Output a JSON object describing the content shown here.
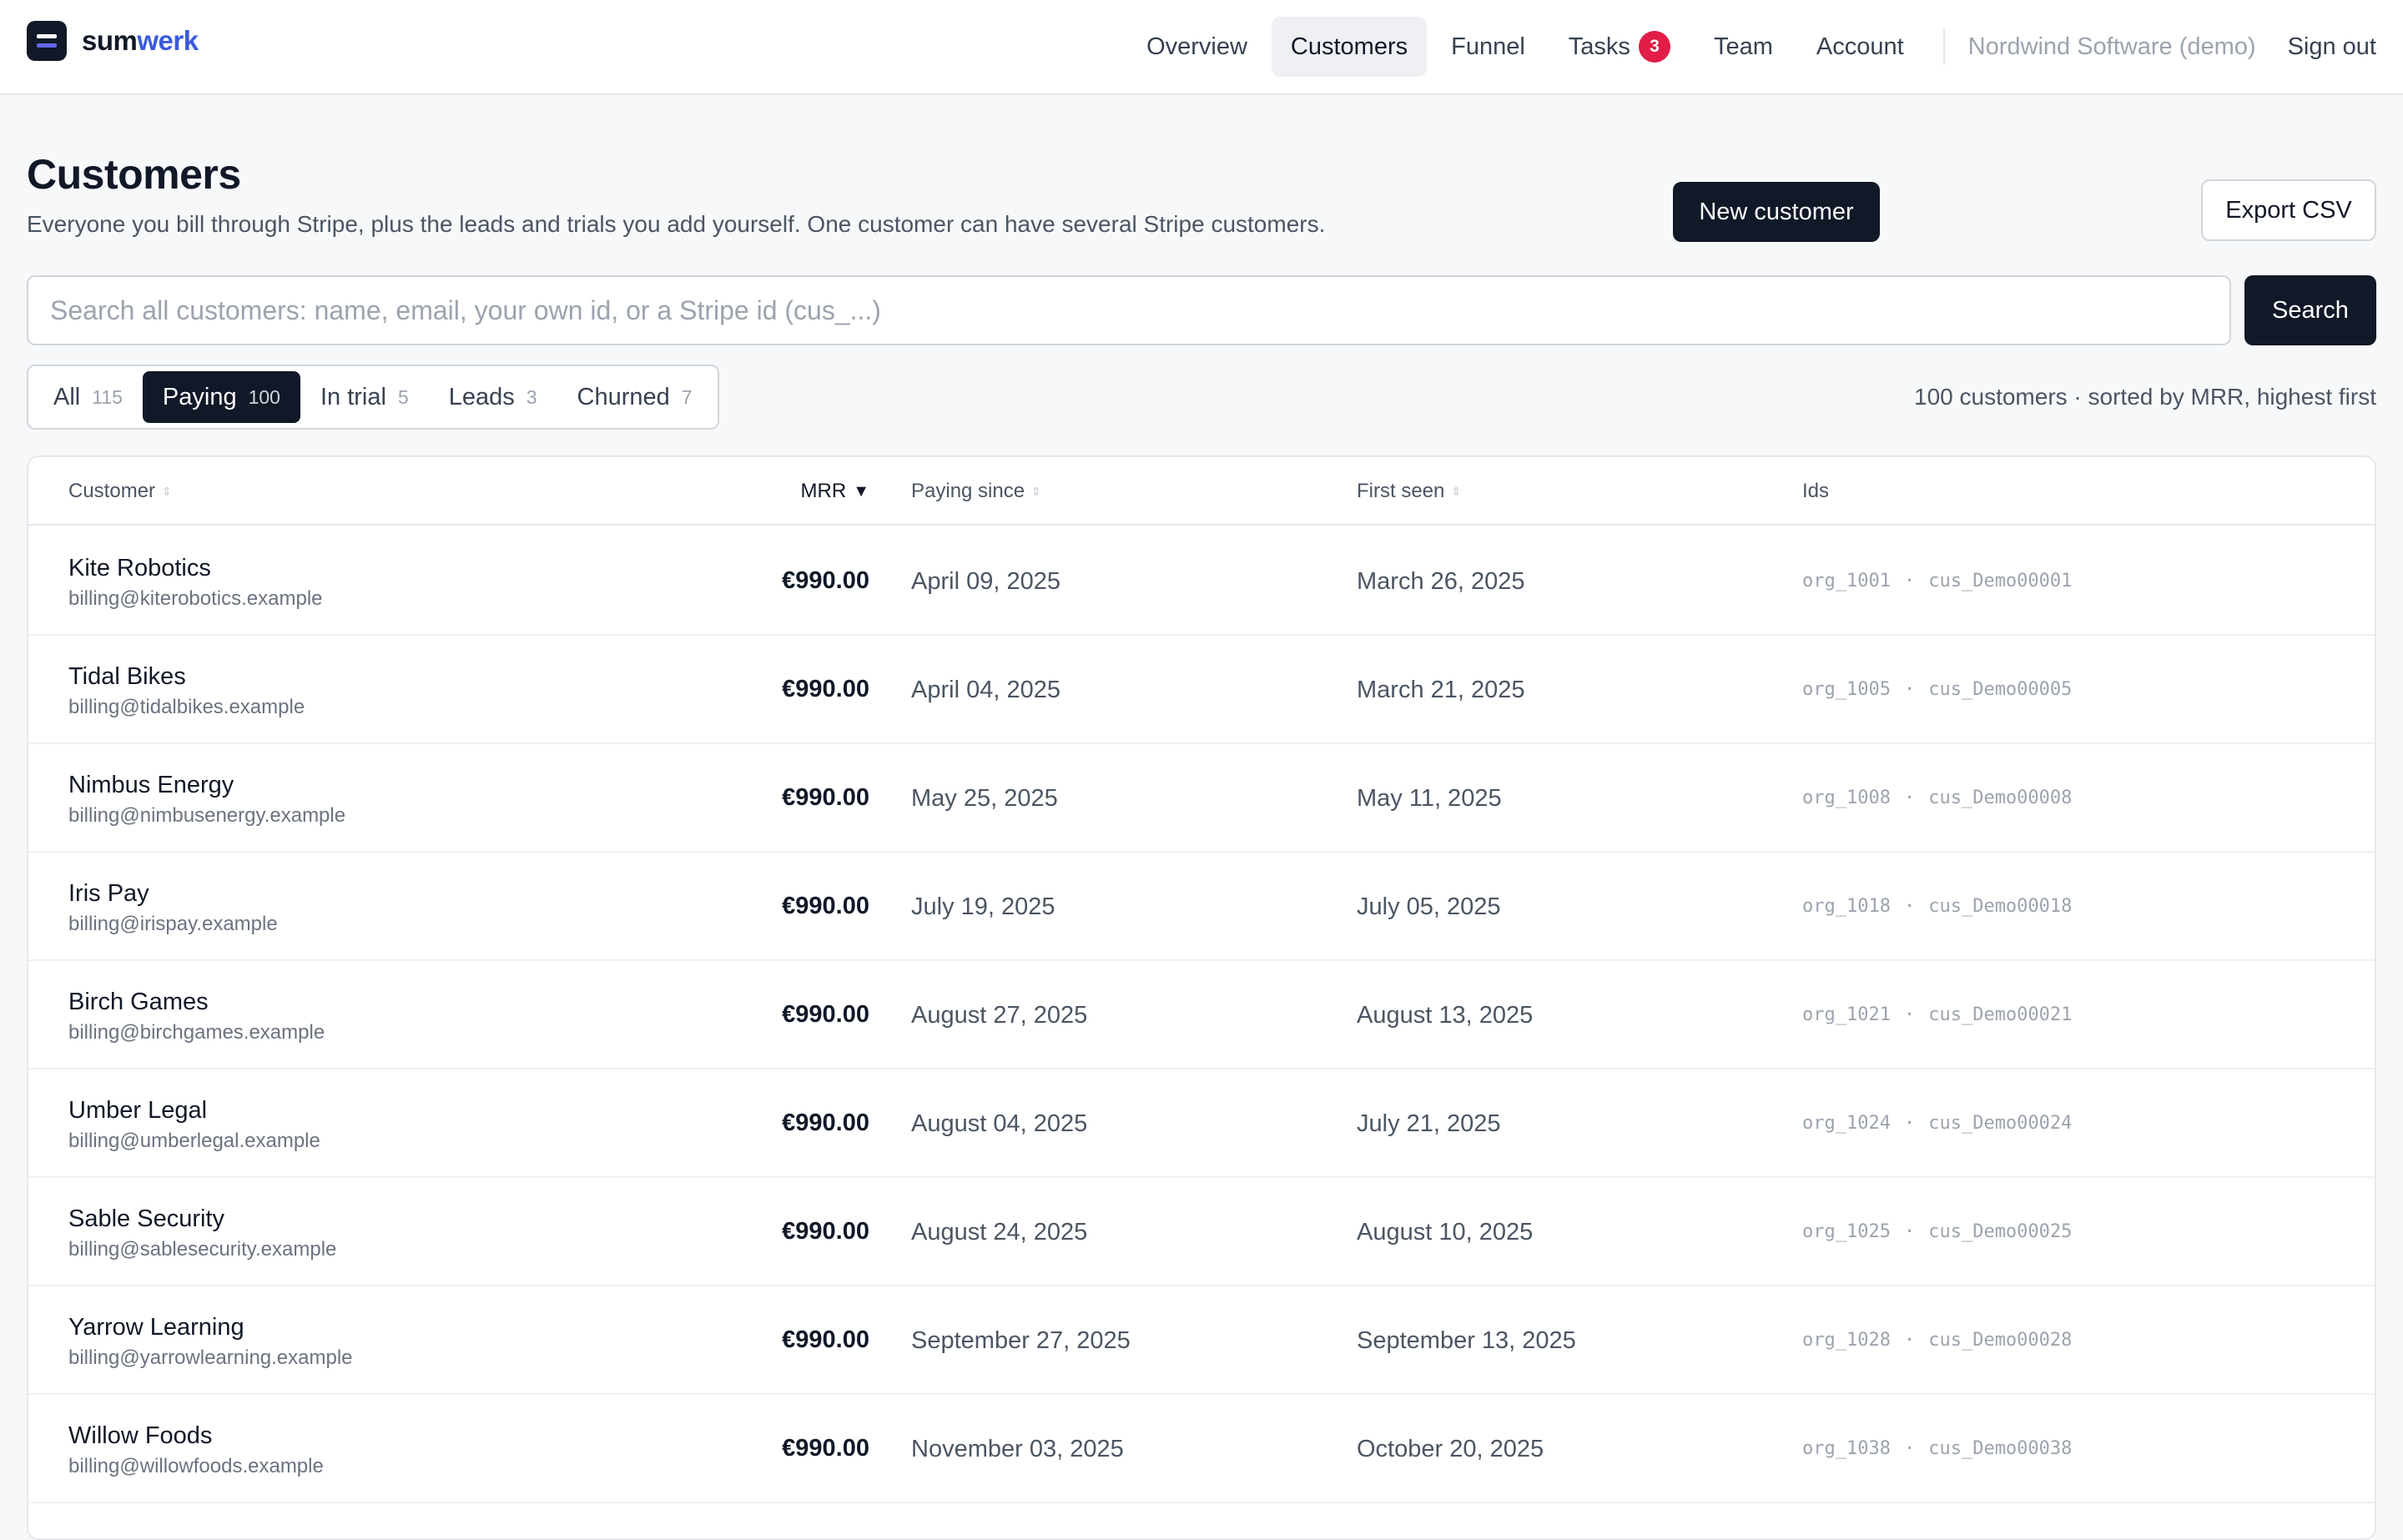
{
  "brand": {
    "name_part1": "sum",
    "name_part2": "werk"
  },
  "nav": {
    "items": [
      {
        "label": "Overview"
      },
      {
        "label": "Customers",
        "active": true
      },
      {
        "label": "Funnel"
      },
      {
        "label": "Tasks",
        "badge": "3"
      },
      {
        "label": "Team"
      },
      {
        "label": "Account"
      }
    ],
    "org_name": "Nordwind Software (demo)",
    "signout_label": "Sign out"
  },
  "header": {
    "title": "Customers",
    "subtitle": "Everyone you bill through Stripe, plus the leads and trials you add yourself. One customer can have several Stripe customers.",
    "new_button": "New customer",
    "export_button": "Export CSV"
  },
  "search": {
    "placeholder": "Search all customers: name, email, your own id, or a Stripe id (cus_...)",
    "button": "Search"
  },
  "filters": [
    {
      "label": "All",
      "count": "115"
    },
    {
      "label": "Paying",
      "count": "100",
      "active": true
    },
    {
      "label": "In trial",
      "count": "5"
    },
    {
      "label": "Leads",
      "count": "3"
    },
    {
      "label": "Churned",
      "count": "7"
    }
  ],
  "result_meta": "100 customers · sorted by MRR, highest first",
  "table": {
    "columns": {
      "customer": "Customer",
      "mrr": "MRR",
      "paying_since": "Paying since",
      "first_seen": "First seen",
      "ids": "Ids"
    },
    "rows": [
      {
        "name": "Kite Robotics",
        "email": "billing@kiterobotics.example",
        "mrr": "€990.00",
        "paying_since": "April 09, 2025",
        "first_seen": "March 26, 2025",
        "org_id": "org_1001",
        "cus_id": "cus_Demo00001"
      },
      {
        "name": "Tidal Bikes",
        "email": "billing@tidalbikes.example",
        "mrr": "€990.00",
        "paying_since": "April 04, 2025",
        "first_seen": "March 21, 2025",
        "org_id": "org_1005",
        "cus_id": "cus_Demo00005"
      },
      {
        "name": "Nimbus Energy",
        "email": "billing@nimbusenergy.example",
        "mrr": "€990.00",
        "paying_since": "May 25, 2025",
        "first_seen": "May 11, 2025",
        "org_id": "org_1008",
        "cus_id": "cus_Demo00008"
      },
      {
        "name": "Iris Pay",
        "email": "billing@irispay.example",
        "mrr": "€990.00",
        "paying_since": "July 19, 2025",
        "first_seen": "July 05, 2025",
        "org_id": "org_1018",
        "cus_id": "cus_Demo00018"
      },
      {
        "name": "Birch Games",
        "email": "billing@birchgames.example",
        "mrr": "€990.00",
        "paying_since": "August 27, 2025",
        "first_seen": "August 13, 2025",
        "org_id": "org_1021",
        "cus_id": "cus_Demo00021"
      },
      {
        "name": "Umber Legal",
        "email": "billing@umberlegal.example",
        "mrr": "€990.00",
        "paying_since": "August 04, 2025",
        "first_seen": "July 21, 2025",
        "org_id": "org_1024",
        "cus_id": "cus_Demo00024"
      },
      {
        "name": "Sable Security",
        "email": "billing@sablesecurity.example",
        "mrr": "€990.00",
        "paying_since": "August 24, 2025",
        "first_seen": "August 10, 2025",
        "org_id": "org_1025",
        "cus_id": "cus_Demo00025"
      },
      {
        "name": "Yarrow Learning",
        "email": "billing@yarrowlearning.example",
        "mrr": "€990.00",
        "paying_since": "September 27, 2025",
        "first_seen": "September 13, 2025",
        "org_id": "org_1028",
        "cus_id": "cus_Demo00028"
      },
      {
        "name": "Willow Foods",
        "email": "billing@willowfoods.example",
        "mrr": "€990.00",
        "paying_since": "November 03, 2025",
        "first_seen": "October 20, 2025",
        "org_id": "org_1038",
        "cus_id": "cus_Demo00038"
      }
    ]
  }
}
